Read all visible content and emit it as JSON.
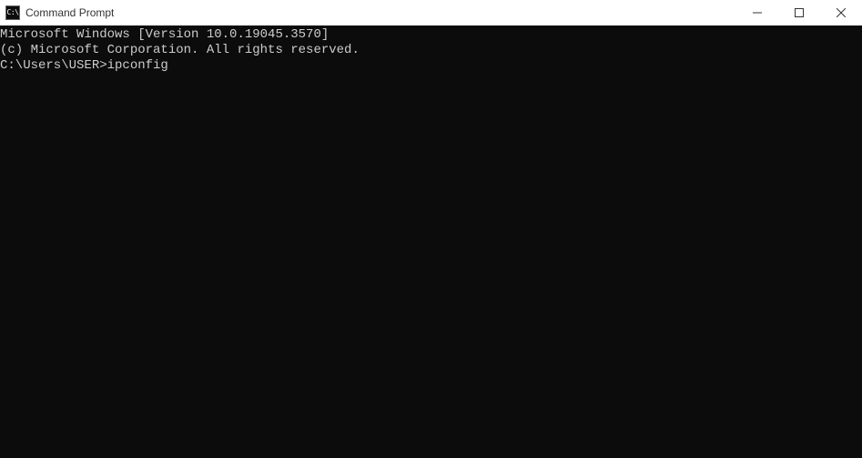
{
  "window": {
    "title": "Command Prompt",
    "icon_label": "C:\\"
  },
  "terminal": {
    "line1": "Microsoft Windows [Version 10.0.19045.3570]",
    "line2": "(c) Microsoft Corporation. All rights reserved.",
    "blank": "",
    "prompt": "C:\\Users\\USER>",
    "command": "ipconfig"
  }
}
